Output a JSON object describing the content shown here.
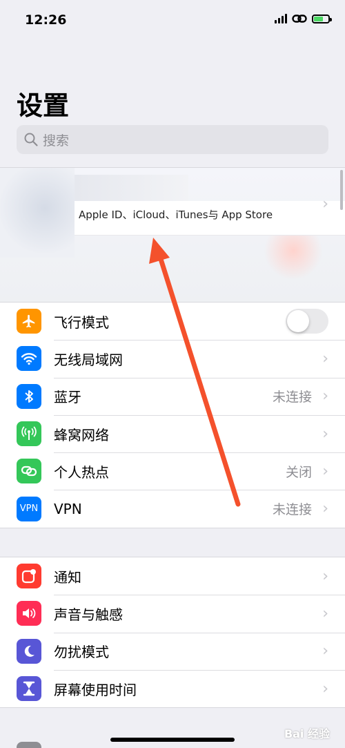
{
  "status_bar": {
    "time": "12:26"
  },
  "header": {
    "title": "设置"
  },
  "search": {
    "placeholder": "搜索"
  },
  "profile": {
    "subtitle": "Apple ID、iCloud、iTunes与 App Store"
  },
  "group1": [
    {
      "label": "飞行模式",
      "icon": "airplane-icon",
      "color": "#ff9500",
      "accessory": "toggle",
      "toggle_on": false
    },
    {
      "label": "无线局域网",
      "icon": "wifi-icon",
      "color": "#007aff",
      "accessory": "chevron"
    },
    {
      "label": "蓝牙",
      "icon": "bluetooth-icon",
      "color": "#007aff",
      "value": "未连接",
      "accessory": "chevron"
    },
    {
      "label": "蜂窝网络",
      "icon": "antenna-icon",
      "color": "#34c759",
      "accessory": "chevron"
    },
    {
      "label": "个人热点",
      "icon": "hotspot-icon",
      "color": "#34c759",
      "value": "关闭",
      "accessory": "chevron"
    },
    {
      "label": "VPN",
      "icon": "vpn-icon",
      "icon_text": "VPN",
      "color": "#007aff",
      "value": "未连接",
      "accessory": "chevron"
    }
  ],
  "group2": [
    {
      "label": "通知",
      "icon": "notifications-icon",
      "color": "#ff3b30",
      "accessory": "chevron"
    },
    {
      "label": "声音与触感",
      "icon": "speaker-icon",
      "color": "#ff2d55",
      "accessory": "chevron"
    },
    {
      "label": "勿扰模式",
      "icon": "moon-icon",
      "color": "#5856d6",
      "accessory": "chevron"
    },
    {
      "label": "屏幕使用时间",
      "icon": "hourglass-icon",
      "color": "#5856d6",
      "accessory": "chevron"
    }
  ],
  "watermark": {
    "text": "Bai 经验"
  },
  "annotation": {
    "arrow_color": "#f4512c"
  }
}
